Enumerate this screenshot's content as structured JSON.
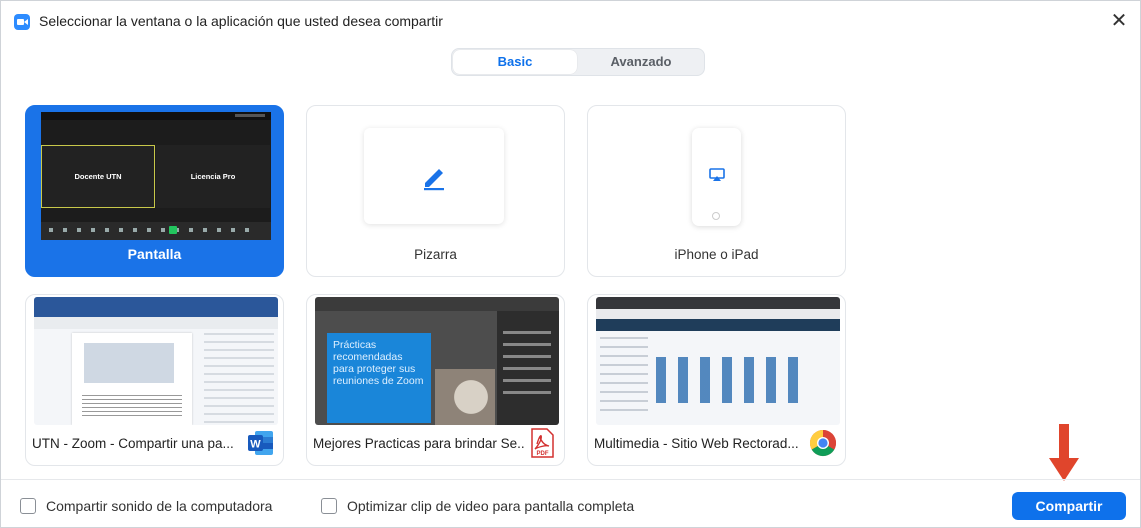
{
  "window": {
    "title": "Seleccionar la ventana o la aplicación que usted desea compartir",
    "close_glyph": "✕"
  },
  "tabs": [
    {
      "label": "Basic",
      "selected": true
    },
    {
      "label": "Avanzado",
      "selected": false
    }
  ],
  "options": [
    {
      "label": "Pantalla",
      "selected": true,
      "icon": "screen-preview",
      "tiles": [
        "Docente UTN",
        "Licencia Pro"
      ]
    },
    {
      "label": "Pizarra",
      "selected": false,
      "icon": "pencil-icon"
    },
    {
      "label": "iPhone o iPad",
      "selected": false,
      "icon": "airplay-icon"
    }
  ],
  "windows": [
    {
      "caption": "UTN - Zoom - Compartir una pa...",
      "app_icon": "word-icon",
      "app_letter": "W"
    },
    {
      "caption": "Mejores Practicas para brindar Se...",
      "app_icon": "pdf-icon",
      "preview_text": "Prácticas recomendadas para proteger sus reuniones de Zoom",
      "app_letter": "PDF"
    },
    {
      "caption": "Multimedia - Sitio Web Rectorad...",
      "app_icon": "chrome-icon"
    }
  ],
  "footer": {
    "share_audio_label": "Compartir sonido de la computadora",
    "share_audio_checked": false,
    "optimize_video_label": "Optimizar clip de video para pantalla completa",
    "optimize_video_checked": false,
    "share_button_label": "Compartir"
  },
  "colors": {
    "accent": "#0e71eb",
    "selected_card": "#1a73e8",
    "annotation_arrow": "#e0452c"
  }
}
